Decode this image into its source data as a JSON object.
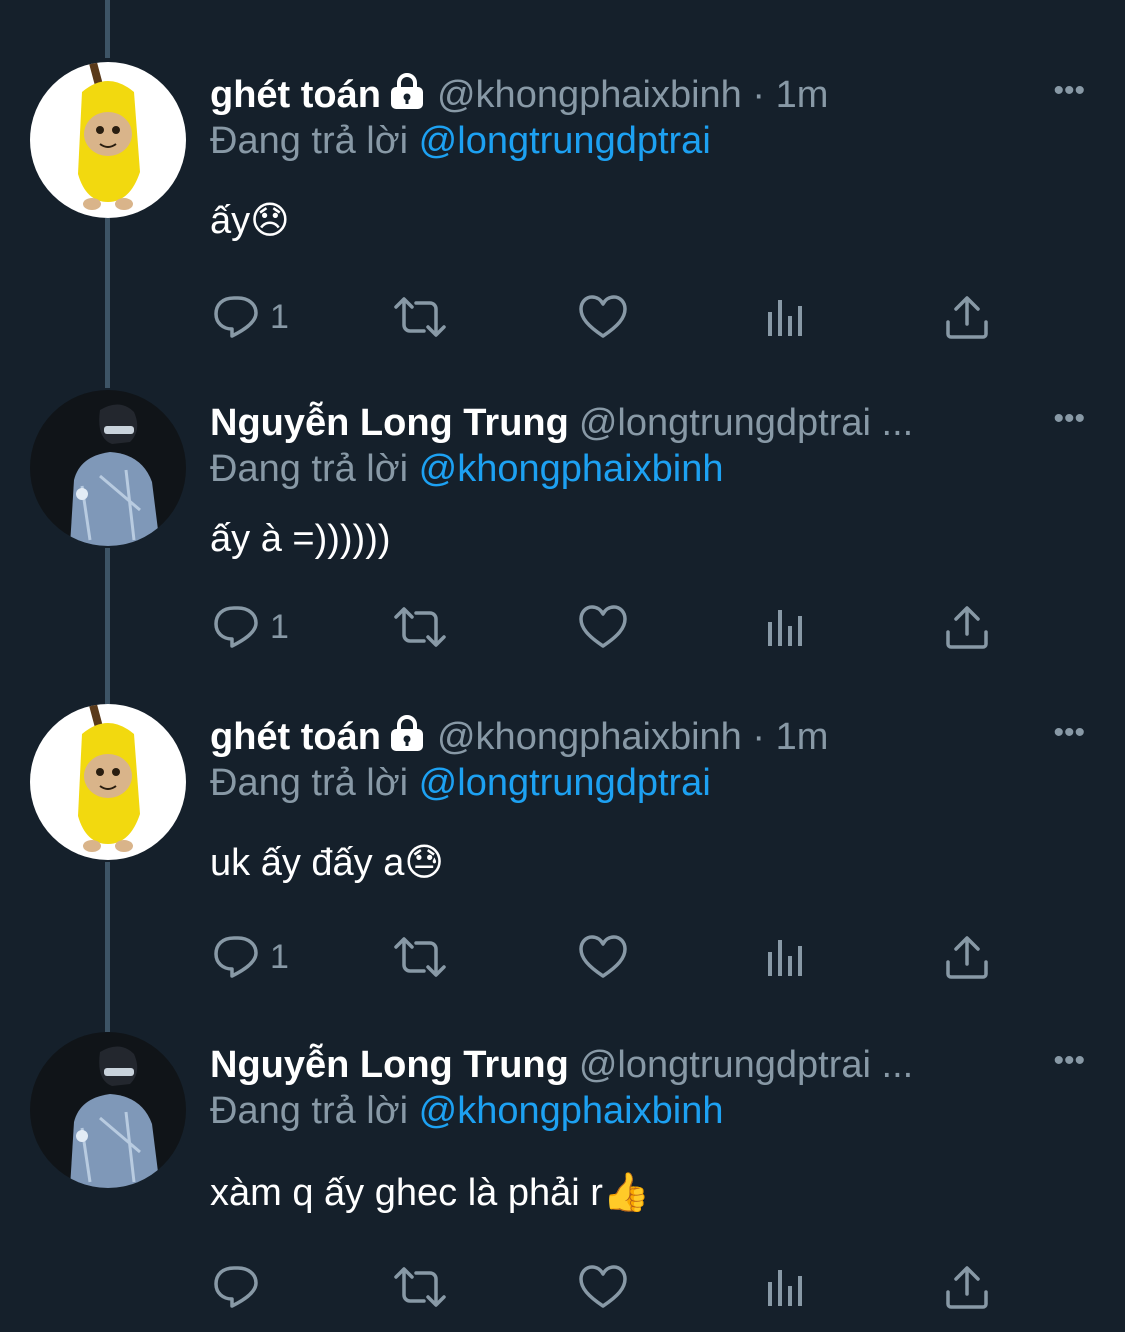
{
  "colors": {
    "background": "#15202b",
    "text_primary": "#ffffff",
    "text_secondary": "#8899a6",
    "mention": "#1da1f2",
    "thread_line": "#3d5466"
  },
  "tweets": [
    {
      "name": "ghét toán",
      "locked": true,
      "handle": "@khongphaixbinh",
      "time": "· 1m",
      "replying_label": "Đang trả lời",
      "replying_to": "@longtrungdptrai",
      "text": "ấy😞",
      "reply_count": "1",
      "avatar": "banana-cat-avatar"
    },
    {
      "name": "Nguyễn Long Trung",
      "locked": false,
      "handle": "@longtrungdptrai ...",
      "time": "",
      "replying_label": "Đang trả lời",
      "replying_to": "@khongphaixbinh",
      "text": "ấy à =))))))",
      "reply_count": "1",
      "avatar": "person-photo-avatar"
    },
    {
      "name": "ghét toán",
      "locked": true,
      "handle": "@khongphaixbinh",
      "time": "· 1m",
      "replying_label": "Đang trả lời",
      "replying_to": "@longtrungdptrai",
      "text": "uk ấy đấy a😓",
      "reply_count": "1",
      "avatar": "banana-cat-avatar"
    },
    {
      "name": "Nguyễn Long Trung",
      "locked": false,
      "handle": "@longtrungdptrai ...",
      "time": "",
      "replying_label": "Đang trả lời",
      "replying_to": "@khongphaixbinh",
      "text": "xàm q ấy ghec là phải r👍",
      "reply_count": "",
      "avatar": "person-photo-avatar"
    }
  ],
  "more_glyph": "•••",
  "icons": [
    "reply-icon",
    "retweet-icon",
    "like-icon",
    "analytics-icon",
    "share-icon",
    "lock-icon",
    "more-icon"
  ]
}
